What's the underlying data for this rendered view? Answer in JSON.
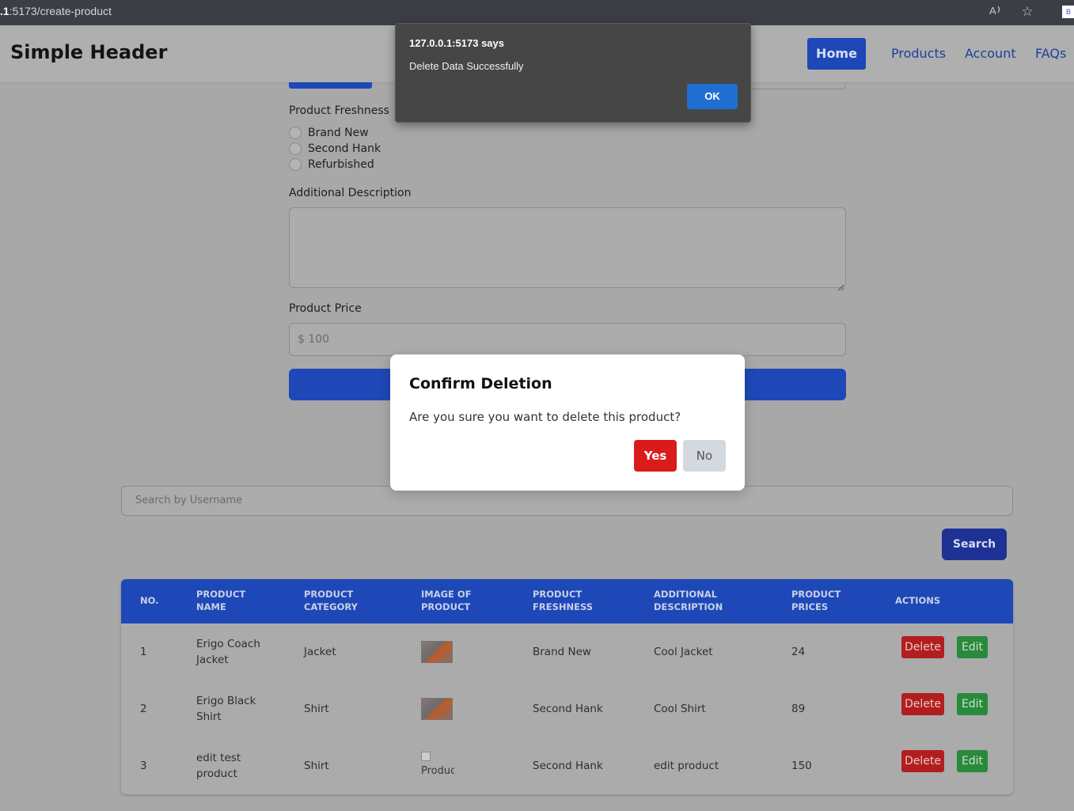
{
  "browser": {
    "url_host_fragment": ".1",
    "url_rest": ":5173/create-product",
    "read_aloud_icon": "read-aloud-icon",
    "favorite_icon": "star-icon",
    "extension_badge": "B"
  },
  "header": {
    "brand": "Simple Header",
    "nav": {
      "home": "Home",
      "products": "Products",
      "account": "Account",
      "faqs": "FAQs"
    }
  },
  "form": {
    "freshness_label": "Product Freshness",
    "freshness_options": [
      "Brand New",
      "Second Hank",
      "Refurbished"
    ],
    "description_label": "Additional Description",
    "description_value": "",
    "price_label": "Product Price",
    "price_placeholder": "$ 100"
  },
  "search": {
    "placeholder": "Search by Username",
    "button": "Search"
  },
  "table": {
    "headers": [
      [
        "No."
      ],
      [
        "Product",
        "Name"
      ],
      [
        "Product",
        "Category"
      ],
      [
        "Image of",
        "Product"
      ],
      [
        "Product",
        "Freshness"
      ],
      [
        "Additional",
        "Description"
      ],
      [
        "Product",
        "Prices"
      ],
      [
        "Actions"
      ]
    ],
    "rows": [
      {
        "no": "1",
        "name": [
          "Erigo Coach",
          "Jacket"
        ],
        "category": "Jacket",
        "image": "thumbnail",
        "freshness": "Brand New",
        "description": "Cool Jacket",
        "price": "24"
      },
      {
        "no": "2",
        "name": [
          "Erigo Black",
          "Shirt"
        ],
        "category": "Shirt",
        "image": "thumbnail",
        "freshness": "Second Hank",
        "description": "Cool Shirt",
        "price": "89"
      },
      {
        "no": "3",
        "name": [
          "edit test",
          "product"
        ],
        "category": "Shirt",
        "image": "broken",
        "image_alt": "Produc",
        "freshness": "Second Hank",
        "description": "edit product",
        "price": "150"
      }
    ],
    "delete_label": "Delete",
    "edit_label": "Edit"
  },
  "alert": {
    "title": "127.0.0.1:5173 says",
    "message": "Delete Data Successfully",
    "ok": "OK"
  },
  "modal": {
    "title": "Confirm Deletion",
    "message": "Are you sure you want to delete this product?",
    "yes": "Yes",
    "no": "No"
  },
  "colors": {
    "primary": "#2563eb",
    "danger": "#dc2626",
    "success": "#16a34a",
    "overlay": "#a8a8a8"
  }
}
